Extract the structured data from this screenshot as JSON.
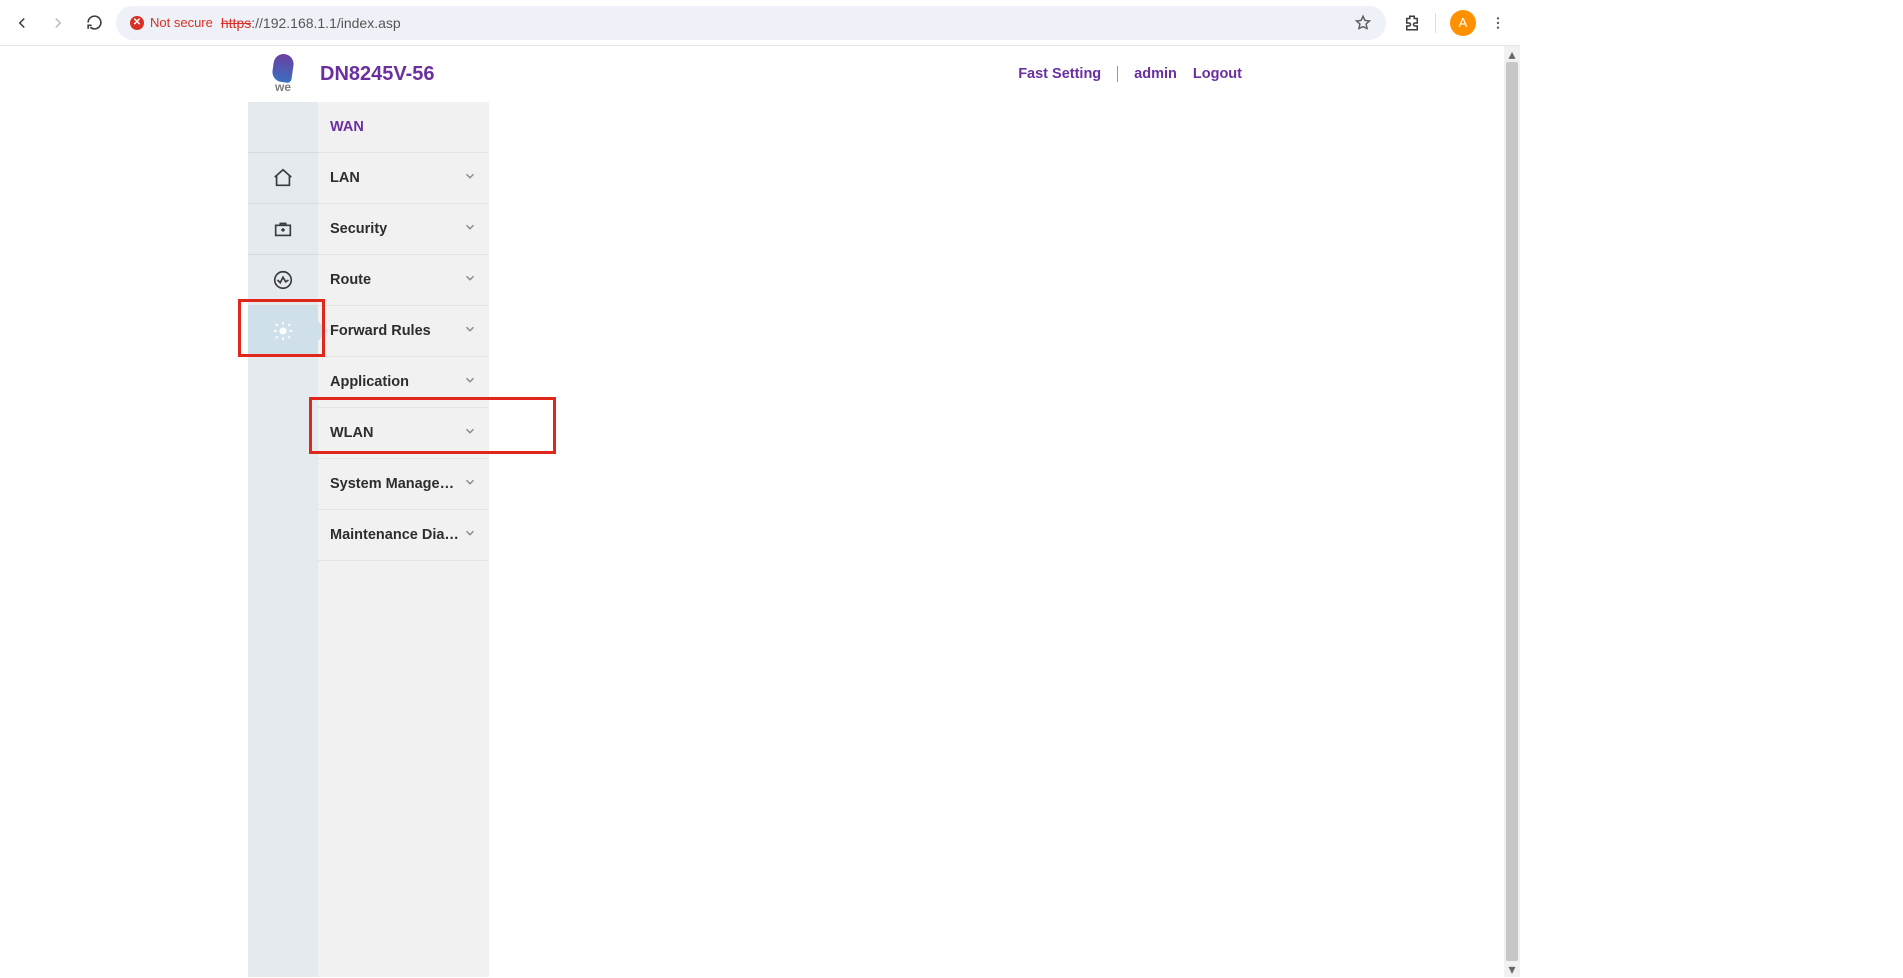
{
  "browser": {
    "not_secure_label": "Not secure",
    "url_https": "https",
    "url_rest": "://192.168.1.1/index.asp",
    "avatar_letter": "A"
  },
  "router": {
    "brand_sub": "we",
    "model": "DN8245V-56",
    "header_links": {
      "fast_setting": "Fast Setting",
      "admin": "admin",
      "logout": "Logout"
    }
  },
  "menu": {
    "items": [
      {
        "label": "WAN",
        "active": true,
        "chevron": false
      },
      {
        "label": "LAN",
        "active": false,
        "chevron": true
      },
      {
        "label": "Security",
        "active": false,
        "chevron": true
      },
      {
        "label": "Route",
        "active": false,
        "chevron": true
      },
      {
        "label": "Forward Rules",
        "active": false,
        "chevron": true
      },
      {
        "label": "Application",
        "active": false,
        "chevron": true
      },
      {
        "label": "WLAN",
        "active": false,
        "chevron": true
      },
      {
        "label": "System Management",
        "active": false,
        "chevron": true
      },
      {
        "label": "Maintenance Diagno",
        "active": false,
        "chevron": true
      }
    ]
  }
}
